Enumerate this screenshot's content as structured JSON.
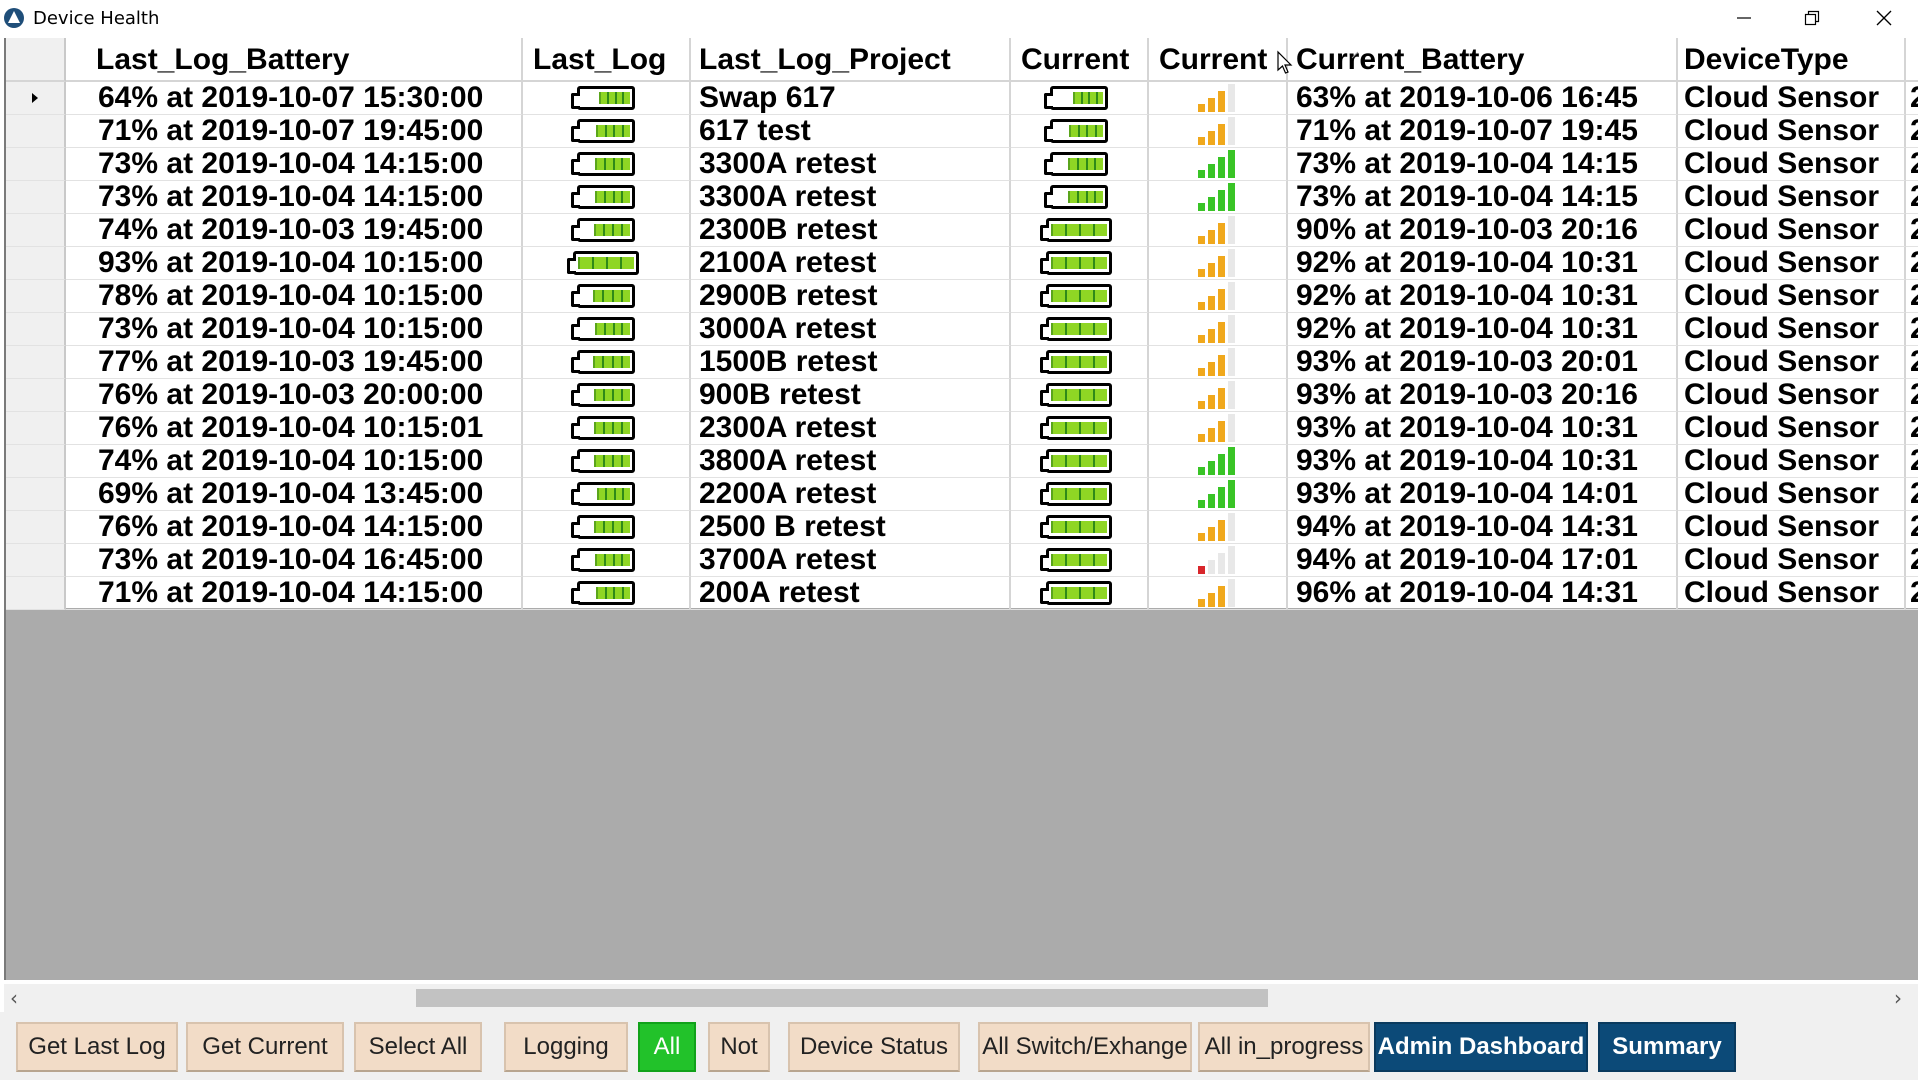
{
  "window": {
    "title": "Device Health"
  },
  "columns": [
    "",
    "Last_Log_Battery",
    "Last_Log",
    "Last_Log_Project",
    "Current",
    "Current",
    "Current_Battery",
    "DeviceType",
    ""
  ],
  "rows": [
    {
      "last_log_battery": "64% at 2019-10-07 15:30:00",
      "last_log_level": 0.64,
      "project": "Swap 617",
      "current_level": 0.63,
      "signal": 3,
      "signal_color": "orange",
      "current_battery": "63% at 2019-10-06 16:45",
      "device_type": "Cloud Sensor",
      "more": "2",
      "selected": true
    },
    {
      "last_log_battery": "71% at 2019-10-07 19:45:00",
      "last_log_level": 0.71,
      "project": "617 test",
      "current_level": 0.71,
      "signal": 3,
      "signal_color": "orange",
      "current_battery": "71% at 2019-10-07 19:45",
      "device_type": "Cloud Sensor",
      "more": "2"
    },
    {
      "last_log_battery": "73% at 2019-10-04 14:15:00",
      "last_log_level": 0.73,
      "project": "3300A retest",
      "current_level": 0.73,
      "signal": 4,
      "signal_color": "green",
      "current_battery": "73% at 2019-10-04 14:15",
      "device_type": "Cloud Sensor",
      "more": "2"
    },
    {
      "last_log_battery": "73% at 2019-10-04 14:15:00",
      "last_log_level": 0.73,
      "project": "3300A retest",
      "current_level": 0.73,
      "signal": 4,
      "signal_color": "green",
      "current_battery": "73% at 2019-10-04 14:15",
      "device_type": "Cloud Sensor",
      "more": "2"
    },
    {
      "last_log_battery": "74% at 2019-10-03 19:45:00",
      "last_log_level": 0.74,
      "project": "2300B retest",
      "current_level": 0.9,
      "signal": 3,
      "signal_color": "orange",
      "current_battery": "90% at 2019-10-03 20:16",
      "device_type": "Cloud Sensor",
      "more": "2"
    },
    {
      "last_log_battery": "93% at 2019-10-04 10:15:00",
      "last_log_level": 0.93,
      "project": "2100A retest",
      "current_level": 0.92,
      "signal": 3,
      "signal_color": "orange",
      "current_battery": "92% at 2019-10-04 10:31",
      "device_type": "Cloud Sensor",
      "more": "2"
    },
    {
      "last_log_battery": "78% at 2019-10-04 10:15:00",
      "last_log_level": 0.78,
      "project": "2900B retest",
      "current_level": 0.92,
      "signal": 3,
      "signal_color": "orange",
      "current_battery": "92% at 2019-10-04 10:31",
      "device_type": "Cloud Sensor",
      "more": "2"
    },
    {
      "last_log_battery": "73% at 2019-10-04 10:15:00",
      "last_log_level": 0.73,
      "project": "3000A retest",
      "current_level": 0.92,
      "signal": 3,
      "signal_color": "orange",
      "current_battery": "92% at 2019-10-04 10:31",
      "device_type": "Cloud Sensor",
      "more": "2"
    },
    {
      "last_log_battery": "77% at 2019-10-03 19:45:00",
      "last_log_level": 0.77,
      "project": "1500B retest",
      "current_level": 0.93,
      "signal": 3,
      "signal_color": "orange",
      "current_battery": "93% at 2019-10-03 20:01",
      "device_type": "Cloud Sensor",
      "more": "2"
    },
    {
      "last_log_battery": "76% at 2019-10-03 20:00:00",
      "last_log_level": 0.76,
      "project": "900B retest",
      "current_level": 0.93,
      "signal": 3,
      "signal_color": "orange",
      "current_battery": "93% at 2019-10-03 20:16",
      "device_type": "Cloud Sensor",
      "more": "2"
    },
    {
      "last_log_battery": "76% at 2019-10-04 10:15:01",
      "last_log_level": 0.76,
      "project": "2300A retest",
      "current_level": 0.93,
      "signal": 3,
      "signal_color": "orange",
      "current_battery": "93% at 2019-10-04 10:31",
      "device_type": "Cloud Sensor",
      "more": "2"
    },
    {
      "last_log_battery": "74% at 2019-10-04 10:15:00",
      "last_log_level": 0.74,
      "project": "3800A retest",
      "current_level": 0.93,
      "signal": 4,
      "signal_color": "green",
      "current_battery": "93% at 2019-10-04 10:31",
      "device_type": "Cloud Sensor",
      "more": "2"
    },
    {
      "last_log_battery": "69% at 2019-10-04 13:45:00",
      "last_log_level": 0.69,
      "project": "2200A retest",
      "current_level": 0.93,
      "signal": 4,
      "signal_color": "green",
      "current_battery": "93% at 2019-10-04 14:01",
      "device_type": "Cloud Sensor",
      "more": "2"
    },
    {
      "last_log_battery": "76% at 2019-10-04 14:15:00",
      "last_log_level": 0.76,
      "project": "2500 B retest",
      "current_level": 0.94,
      "signal": 3,
      "signal_color": "orange",
      "current_battery": "94% at 2019-10-04 14:31",
      "device_type": "Cloud Sensor",
      "more": "2"
    },
    {
      "last_log_battery": "73% at 2019-10-04 16:45:00",
      "last_log_level": 0.73,
      "project": "3700A retest",
      "current_level": 0.94,
      "signal": 1,
      "signal_color": "red",
      "current_battery": "94% at 2019-10-04 17:01",
      "device_type": "Cloud Sensor",
      "more": "2"
    },
    {
      "last_log_battery": "71% at 2019-10-04 14:15:00",
      "last_log_level": 0.71,
      "project": "200A retest",
      "current_level": 0.96,
      "signal": 3,
      "signal_color": "orange",
      "current_battery": "96% at 2019-10-04 14:31",
      "device_type": "Cloud Sensor",
      "more": "2"
    }
  ],
  "colors": {
    "battery_green": "#8fd624",
    "signal_orange": "#f0a81c",
    "signal_green": "#39c426",
    "signal_red": "#d8262b",
    "signal_empty": "#e8e8e8",
    "button_peach": "#f2dcc7",
    "button_green": "#22c22a",
    "button_navy": "#0c4a78"
  },
  "toolbar": {
    "get_last_log": "Get Last Log",
    "get_current": "Get Current",
    "select_all": "Select All",
    "logging": "Logging",
    "all": "All",
    "not": "Not",
    "device_status": "Device Status",
    "all_switch": "All Switch/Exhange",
    "all_in_progress": "All in_progress",
    "admin_dashboard": "Admin Dashboard",
    "summary": "Summary"
  }
}
